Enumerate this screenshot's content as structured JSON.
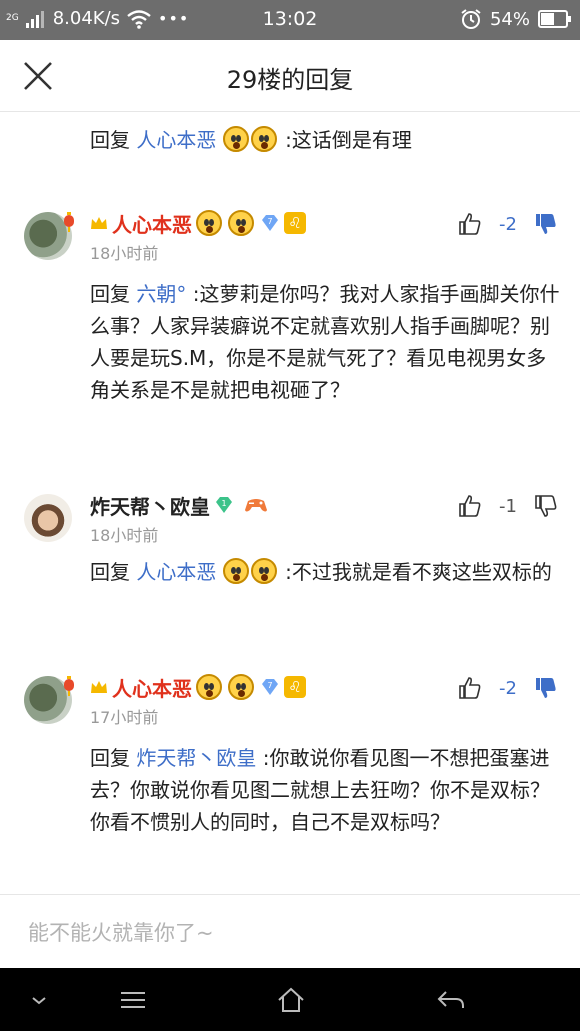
{
  "status": {
    "net_type": "2G",
    "speed": "8.04K/s",
    "dots": "•••",
    "time": "13:02",
    "battery": "54%"
  },
  "header": {
    "title": "29楼的回复"
  },
  "partial": {
    "prefix": "回复 ",
    "mention": "人心本恶",
    "text": " :这话倒是有理"
  },
  "comments": [
    {
      "user": "人心本恶",
      "level": "7",
      "badge": "♌",
      "time": "18小时前",
      "votes": "-2",
      "reply_prefix": "回复 ",
      "mention": "六朝°",
      "text": " :这萝莉是你吗？我对人家指手画脚关你什么事？人家异装癖说不定就喜欢别人指手画脚呢？别人要是玩S.M，你是不是就气死了？看见电视男女多角关系是不是就把电视砸了？"
    },
    {
      "user": "炸天帮丶欧皇",
      "level": "1",
      "time": "18小时前",
      "votes": "-1",
      "reply_prefix": "回复 ",
      "mention": "人心本恶",
      "text": " :不过我就是看不爽这些双标的"
    },
    {
      "user": "人心本恶",
      "level": "7",
      "badge": "♌",
      "time": "17小时前",
      "votes": "-2",
      "reply_prefix": "回复 ",
      "mention": "炸天帮丶欧皇",
      "text": " :你敢说你看见图一不想把蛋塞进去？你敢说你看见图二就想上去狂吻？你不是双标？你看不惯别人的同时，自己不是双标吗？"
    }
  ],
  "input": {
    "placeholder": "能不能火就靠你了~"
  },
  "colors": {
    "accent": "#3e6ec8",
    "username_red": "#e0311c",
    "statusbar": "#6d6d6d"
  },
  "icons": [
    "signal-icon",
    "wifi-icon",
    "alarm-icon",
    "battery-icon",
    "close-icon",
    "thumb-up-icon",
    "thumb-down-icon",
    "crown-icon",
    "diamond-level-icon",
    "gamepad-icon",
    "nav-back-icon",
    "nav-home-icon",
    "nav-menu-icon",
    "nav-down-icon"
  ]
}
